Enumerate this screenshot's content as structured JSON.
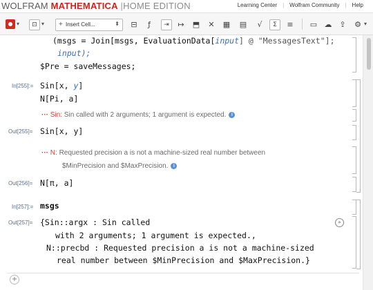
{
  "brand": {
    "wolfram": "WOLFRAM",
    "mathematica": "MATHEMATICA",
    "divider": "|",
    "edition": "HOME EDITION"
  },
  "top_links": [
    "Learning Center",
    "Wolfram Community",
    "Help"
  ],
  "toolbar": {
    "insert_cell": "Insert Cell..."
  },
  "cells": {
    "pre_line1_a": "(msgs = Join[msgs, EvaluationData[",
    "pre_line1_input": "input",
    "pre_line1_b": "] @ \"MessagesText\"];",
    "pre_line2": "input);",
    "pre_line3": "$Pre = saveMessages;",
    "in255_label": "In[255]:=",
    "in255_line1_a": "Sin[x, ",
    "in255_line1_y": "y",
    "in255_line1_b": "]",
    "in255_line2": "N[Pi, a]",
    "msg_sin_dots": "···",
    "msg_sin_tag": "Sin:",
    "msg_sin_text": "Sin called with 2 arguments; 1 argument is expected.",
    "out255_label": "Out[255]=",
    "out255_value": "Sin[x, y]",
    "msg_n_dots": "···",
    "msg_n_tag": "N:",
    "msg_n_text1": "Requested precision a is not a machine-sized real number between",
    "msg_n_text2": "$MinPrecision and $MaxPrecision.",
    "out256_label": "Out[256]=",
    "out256_value": "N[π, a]",
    "in257_label": "In[257]:=",
    "in257_value": "msgs",
    "out257_label": "Out[257]=",
    "out257_line1": "{Sin::argx : Sin called",
    "out257_line2": "with 2 arguments; 1 argument is expected.,",
    "out257_line3": "N::precbd : Requested precision a is not a machine-sized",
    "out257_line4": "real number between $MinPrecision and $MaxPrecision.}"
  },
  "icons": {
    "info": "i",
    "expand": "»",
    "insert_plus": "+"
  }
}
